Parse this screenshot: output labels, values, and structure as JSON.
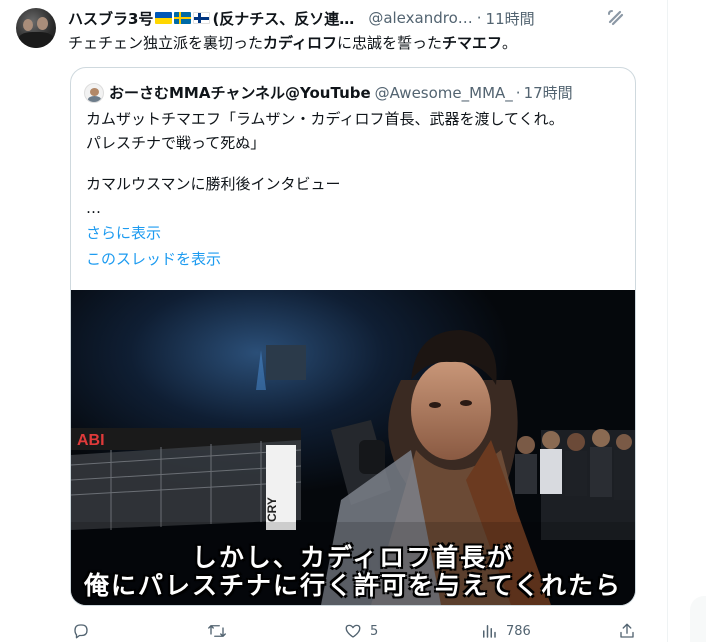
{
  "post": {
    "author": {
      "display_name": "ハスブラ3号",
      "name_suffix": "(反ナチス、反ソ連…",
      "handle": "@alexandro…",
      "time": "11時間"
    },
    "text_parts": [
      {
        "text": "チェチェン独立派を裏切った",
        "bold": false
      },
      {
        "text": "カディロフ",
        "bold": true
      },
      {
        "text": "に忠誠を誓った",
        "bold": false
      },
      {
        "text": "チマエフ",
        "bold": true
      },
      {
        "text": "。",
        "bold": false
      }
    ]
  },
  "quote": {
    "author": {
      "display_name": "おーさむMMAチャンネル@YouTube",
      "handle": "@Awesome_MMA_",
      "time": "17時間"
    },
    "lines": [
      "カムザットチマエフ「ラムザン・カディロフ首長、武器を渡してくれ。",
      "パレスチナで戦って死ぬ」",
      "カマルウスマンに勝利後インタビュー",
      "…"
    ],
    "show_more": "さらに表示",
    "show_thread": "このスレッドを表示",
    "video": {
      "caption_line1": "しかし、カディロフ首長が",
      "caption_line2": "俺にパレスチナに行く許可を与えてくれたら",
      "banner_text": "ABI",
      "corner_text": "CRY"
    }
  },
  "actions": {
    "replies": "",
    "reposts": "",
    "likes": "5",
    "views": "786"
  },
  "icons": [
    "reply-icon",
    "repost-icon",
    "like-icon",
    "views-icon",
    "share-icon",
    "grok-icon"
  ],
  "colors": {
    "text": "#0f1419",
    "secondary": "#536471",
    "link": "#1d9bf0",
    "border": "#cfd9de"
  }
}
